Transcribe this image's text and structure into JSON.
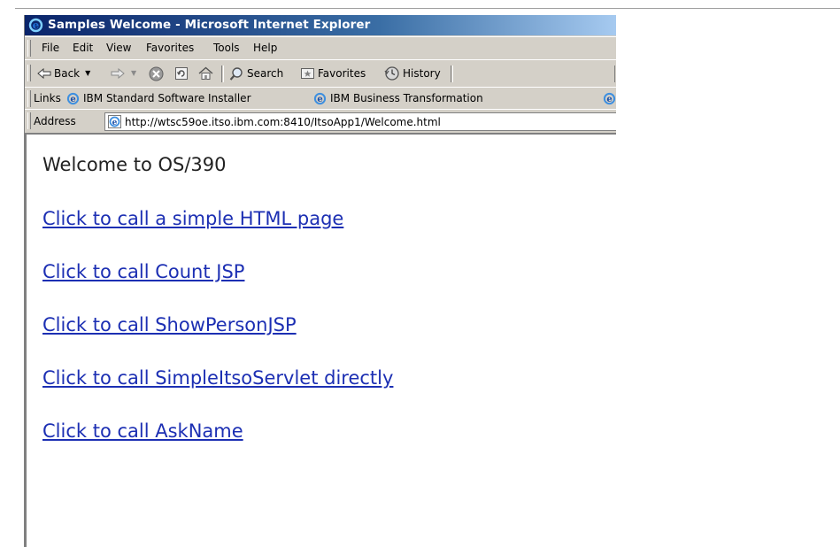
{
  "window": {
    "title": "Samples Welcome - Microsoft Internet Explorer"
  },
  "menu": {
    "items": [
      "File",
      "Edit",
      "View",
      "Favorites",
      "Tools",
      "Help"
    ]
  },
  "toolbar": {
    "back": "Back",
    "search": "Search",
    "favorites": "Favorites",
    "history": "History"
  },
  "links_bar": {
    "label": "Links",
    "items": [
      "IBM Standard Software Installer",
      "IBM Business Transformation"
    ]
  },
  "address_bar": {
    "label": "Address",
    "url": "http://wtsc59oe.itso.ibm.com:8410/ItsoApp1/Welcome.html"
  },
  "page": {
    "heading": "Welcome to OS/390",
    "links": [
      "Click to call a simple HTML page",
      "Click to call Count JSP",
      "Click to call ShowPersonJSP",
      "Click to call SimpleItsoServlet directly",
      "Click to call AskName"
    ]
  },
  "colors": {
    "link": "#1c2fb3",
    "titlebar_start": "#0a246a",
    "titlebar_end": "#a6caf0"
  }
}
